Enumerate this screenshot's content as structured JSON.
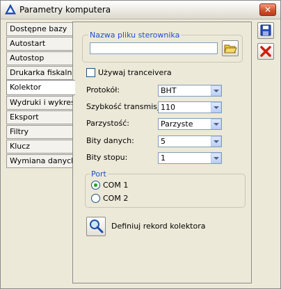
{
  "window": {
    "title": "Parametry komputera"
  },
  "tabs": [
    {
      "label": "Dostępne bazy"
    },
    {
      "label": "Autostart"
    },
    {
      "label": "Autostop"
    },
    {
      "label": "Drukarka fiskalna"
    },
    {
      "label": "Kolektor"
    },
    {
      "label": "Wydruki i wykresy"
    },
    {
      "label": "Eksport"
    },
    {
      "label": "Filtry"
    },
    {
      "label": "Klucz"
    },
    {
      "label": "Wymiana danych"
    }
  ],
  "active_tab": "Kolektor",
  "driver_file": {
    "group_label": "Nazwa pliku sterownika",
    "value": ""
  },
  "transceiver": {
    "label": "Używaj tranceivera",
    "checked": false
  },
  "fields": [
    {
      "label": "Protokół:",
      "value": "BHT"
    },
    {
      "label": "Szybkość transmisji:",
      "value": "110"
    },
    {
      "label": "Parzystość:",
      "value": "Parzyste"
    },
    {
      "label": "Bity danych:",
      "value": "5"
    },
    {
      "label": "Bity stopu:",
      "value": "1"
    }
  ],
  "port": {
    "group_label": "Port",
    "options": [
      {
        "label": "COM 1",
        "selected": true
      },
      {
        "label": "COM 2",
        "selected": false
      }
    ]
  },
  "define_button": {
    "label": "Definiuj rekord kolektora"
  },
  "icons": {
    "save": "save-icon",
    "cancel": "cancel-icon",
    "browse": "folder-open-icon",
    "search": "magnifier-icon"
  }
}
